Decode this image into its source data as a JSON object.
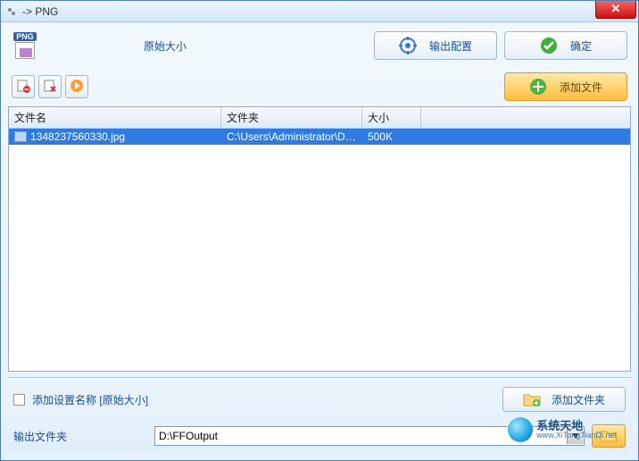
{
  "window": {
    "title": "-> PNG"
  },
  "top": {
    "png_tag": "PNG",
    "original_size_label": "原始大小",
    "output_config": "输出配置",
    "ok": "确定"
  },
  "add_files": "添加文件",
  "table": {
    "headers": {
      "name": "文件名",
      "folder": "文件夹",
      "size": "大小"
    },
    "rows": [
      {
        "name": "1348237560330.jpg",
        "folder": "C:\\Users\\Administrator\\Des...",
        "size": "500K"
      }
    ]
  },
  "bottom": {
    "append_setting_name": "添加设置名称",
    "bracket_text": "[原始大小]",
    "add_folder": "添加文件夹",
    "output_folder_label": "输出文件夹",
    "output_folder_value": "D:\\FFOutput"
  },
  "watermark": {
    "line1": "系统天地",
    "line2": "www.XiTongTianDi.net"
  }
}
